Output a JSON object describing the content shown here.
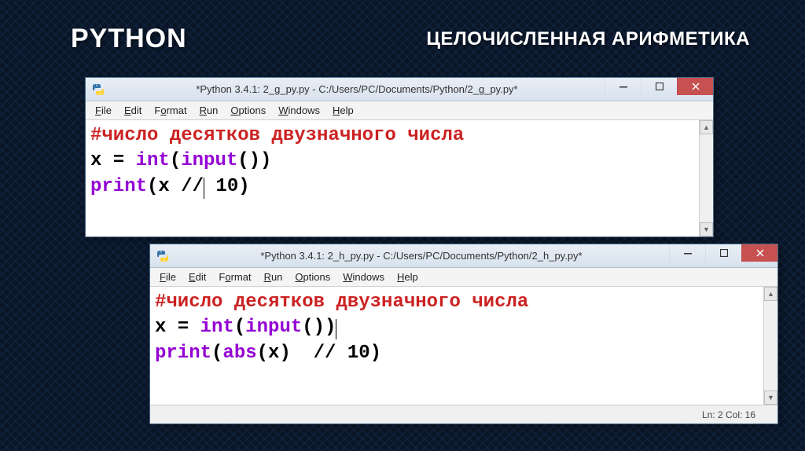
{
  "slide": {
    "title": "PYTHON",
    "subtitle": "ЦЕЛОЧИСЛЕННАЯ АРИФМЕТИКА"
  },
  "menu": {
    "file": "File",
    "edit": "Edit",
    "format": "Format",
    "run": "Run",
    "options": "Options",
    "windows": "Windows",
    "help": "Help"
  },
  "window1": {
    "title": "*Python 3.4.1: 2_g_py.py - C:/Users/PC/Documents/Python/2_g_py.py*",
    "code": {
      "comment": "#число десятков двузначного числа",
      "l2_x": "x = ",
      "l2_int": "int",
      "l2_p1": "(",
      "l2_input": "input",
      "l2_p2": "())",
      "l3_print": "print",
      "l3_p1": "(x //",
      "l3_rest": " 10)"
    }
  },
  "window2": {
    "title": "*Python 3.4.1: 2_h_py.py - C:/Users/PC/Documents/Python/2_h_py.py*",
    "code": {
      "comment": "#число десятков двузначного числа",
      "l2_x": "x = ",
      "l2_int": "int",
      "l2_p1": "(",
      "l2_input": "input",
      "l2_p2": "())",
      "l3_print": "print",
      "l3_p1": "(",
      "l3_abs": "abs",
      "l3_p2": "(x)  // 10)"
    },
    "status": "Ln: 2 Col: 16"
  }
}
